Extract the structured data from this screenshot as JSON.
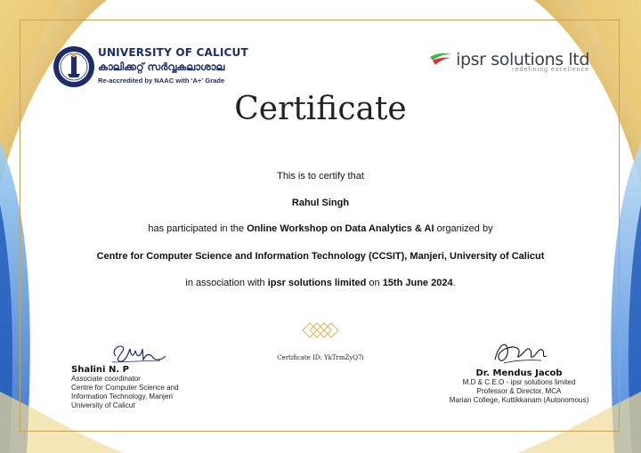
{
  "university": {
    "name": "UNIVERSITY OF CALICUT",
    "name_ml": "കാലിക്കറ്റ് സർവ്വകലാശാല",
    "accreditation": "Re-accredited by NAAC with 'A+' Grade"
  },
  "partner": {
    "name": "ipsr solutions ltd",
    "tagline": "redefining excellence"
  },
  "certificate": {
    "title": "Certificate",
    "line1": "This is to certify that",
    "recipient": "Rahul Singh",
    "line3_pre": "has participated in the ",
    "event": "Online Workshop on Data Analytics & AI",
    "line3_post": " organized by",
    "organizer": "Centre for Computer Science and Information Technology (CCSIT), Manjeri, University of Calicut",
    "line5_pre": "in association with ",
    "partner_bold": "ipsr solutions limited",
    "line5_mid": " on ",
    "date": "15th June 2024",
    "line5_post": ".",
    "id_label": "Certificate ID:",
    "id_value": "YkTrmZyQ7i"
  },
  "signatories": {
    "left": {
      "name": "Shalini N. P",
      "role1": "Associate coordinator",
      "role2": "Centre for Computer Science and",
      "role3": "Information Technology, Manjeri",
      "role4": "University of Calicut"
    },
    "right": {
      "name": "Dr. Mendus Jacob",
      "role1": "M.D & C.E.O - ipsr solutions limited",
      "role2": "Professor & Director, MCA",
      "role3": "Marian College, Kuttikkanam (Autonomous)"
    }
  },
  "colors": {
    "gold": "#e6c46a",
    "blue": "#2a66c9",
    "navy": "#1d2d6b",
    "ipsr_green": "#39b54a",
    "ipsr_red": "#e2322b"
  }
}
